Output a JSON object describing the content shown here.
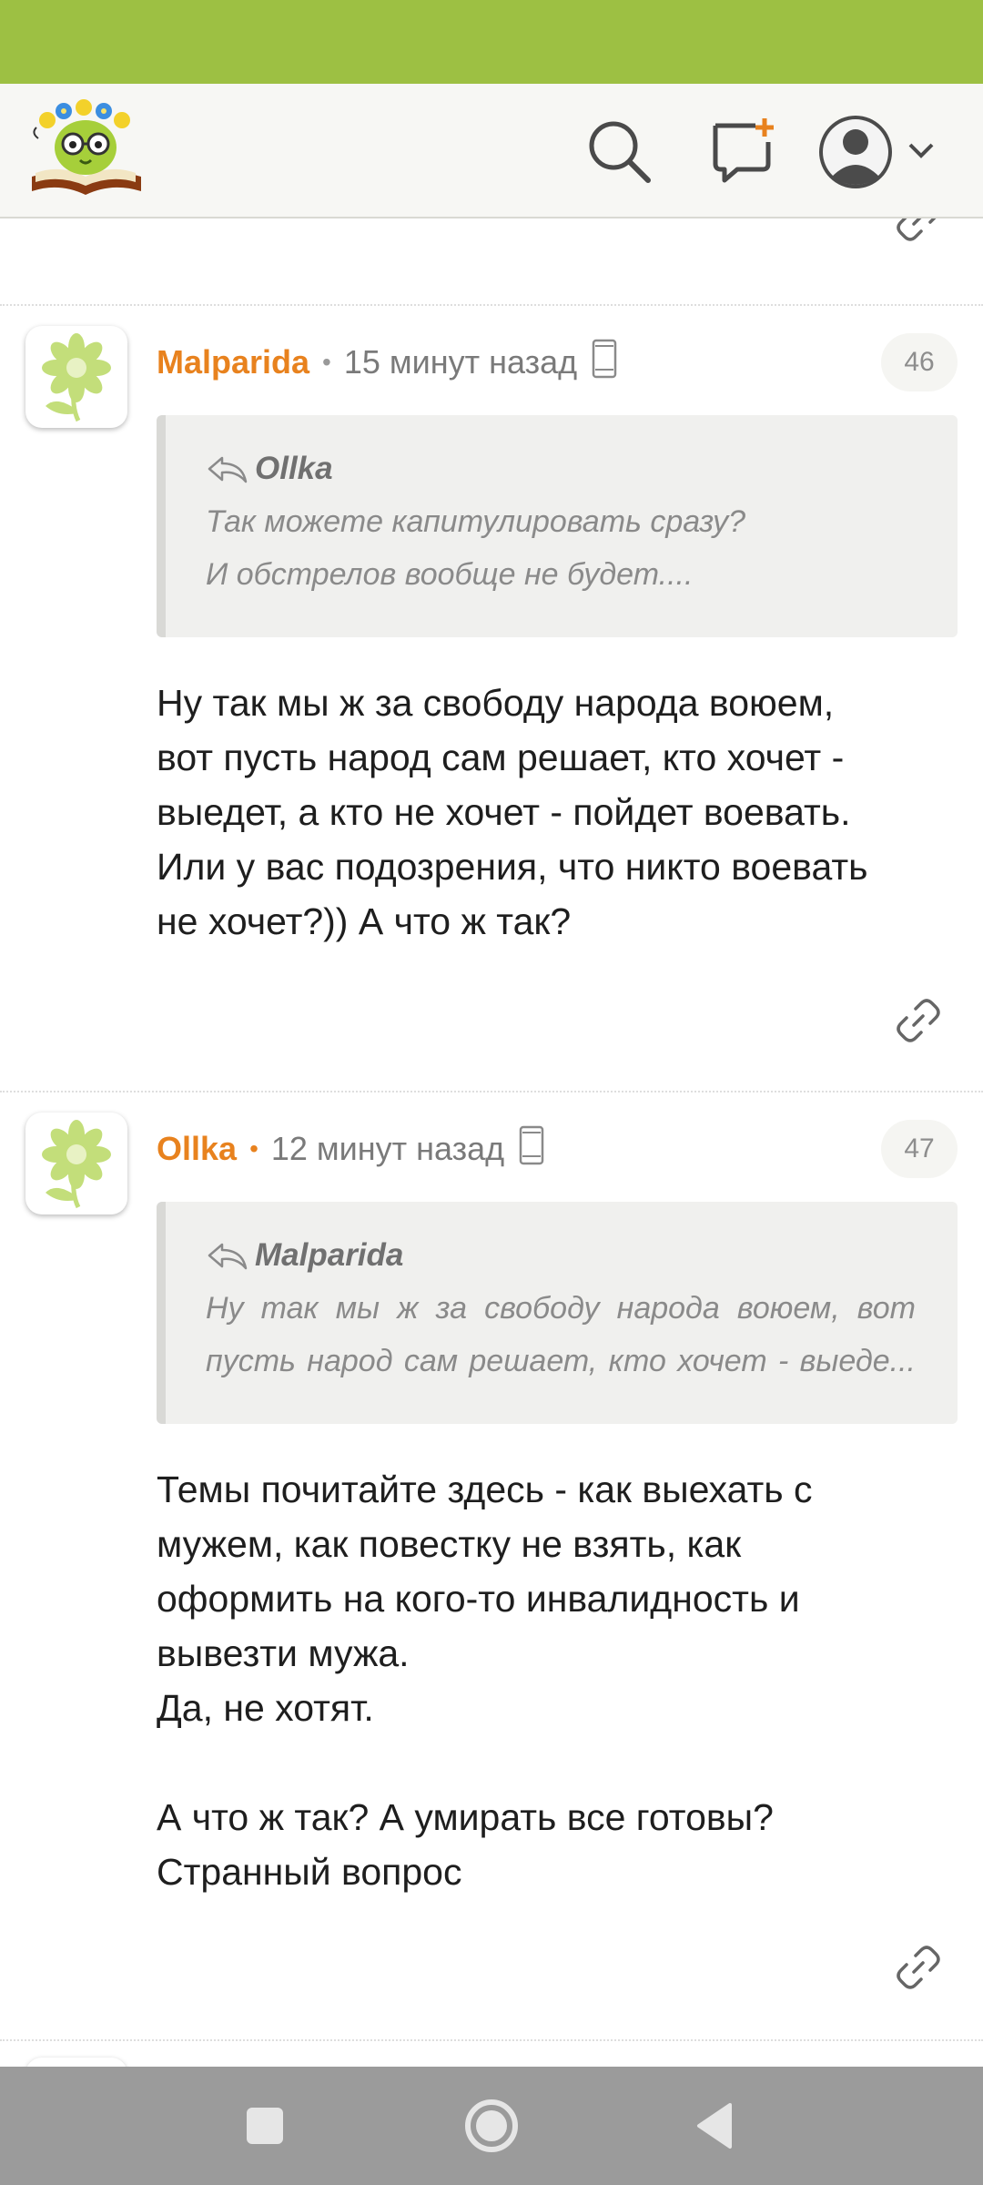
{
  "header": {
    "logo": "reading-bee-logo",
    "icons": [
      "search-icon",
      "new-message-icon",
      "user-avatar-icon",
      "chevron-down-icon"
    ]
  },
  "posts": [
    {
      "author": "Malparida",
      "time": "15 минут назад",
      "number": "46",
      "quote": {
        "author": "Ollka",
        "lines": [
          "Так можете капитулировать сразу?",
          "И обстрелов вообще не будет...."
        ]
      },
      "text": "Ну так мы ж за свободу народа воюем,\nвот пусть народ сам решает, кто хочет -\nвыедет, а кто не хочет - пойдет воевать.\nИли у вас подозрения, что никто воевать\nне хочет?)) А что ж так?"
    },
    {
      "author": "Ollka",
      "time": "12 минут назад",
      "number": "47",
      "quote": {
        "author": "Malparida",
        "lines": [
          "Ну так мы ж за свободу народа воюем, вот",
          "пусть народ сам решает, кто хочет - выеде..."
        ]
      },
      "text": "Темы почитайте здесь - как выехать с\nмужем, как повестку не взять, как\nоформить на кого-то инвалидность и\nвывезти мужа.\nДа, не хотят.\n\nА что ж так? А умирать все готовы?\nСтранный вопрос"
    }
  ],
  "navbar": [
    "recents-button",
    "home-button",
    "back-button"
  ],
  "colors": {
    "status_bar": "#9dc043",
    "author": "#e8821e",
    "header_bg": "#f7f7f4",
    "nav_bar": "#9b9b9b"
  }
}
